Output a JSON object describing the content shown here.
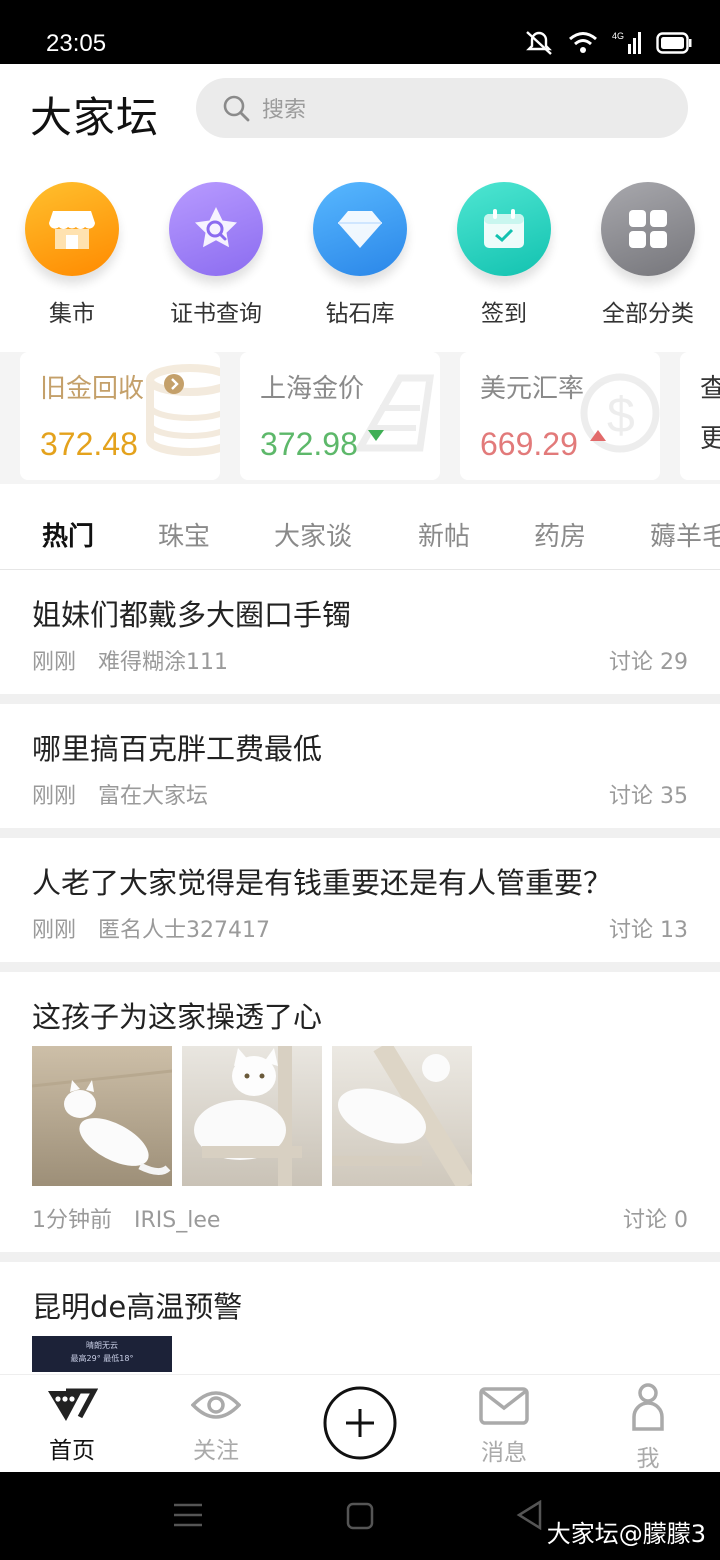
{
  "status": {
    "time": "23:05",
    "network": "4G"
  },
  "header": {
    "logo": "大家坛",
    "search_placeholder": "搜索"
  },
  "categories": [
    {
      "label": "集市",
      "icon": "shop-icon",
      "color": "#ff9a12"
    },
    {
      "label": "证书查询",
      "icon": "certificate-search-icon",
      "color": "#9b7cf0"
    },
    {
      "label": "钻石库",
      "icon": "diamond-icon",
      "color": "#3a9bf0"
    },
    {
      "label": "签到",
      "icon": "calendar-checkin-icon",
      "color": "#25d0c0"
    },
    {
      "label": "全部分类",
      "icon": "grid-icon",
      "color": "#8e8e93"
    }
  ],
  "price_cards": [
    {
      "title": "旧金回收",
      "value": "372.48",
      "title_color": "#c4a06a",
      "value_color": "#e4a21c",
      "has_arrow_link": true
    },
    {
      "title": "上海金价",
      "value": "372.98",
      "title_color": "#8a8a8a",
      "value_color": "#5db86a",
      "trend": "down"
    },
    {
      "title": "美元汇率",
      "value": "669.29",
      "title_color": "#8a8a8a",
      "value_color": "#e27a7a",
      "trend": "up"
    },
    {
      "title": "查",
      "value": "更",
      "title_color": "#333",
      "value_color": "#333"
    }
  ],
  "tabs": [
    "热门",
    "珠宝",
    "大家谈",
    "新帖",
    "药房",
    "薅羊毛"
  ],
  "posts": [
    {
      "title": "姐妹们都戴多大圈口手镯",
      "time": "刚刚",
      "author": "难得糊涂111",
      "discuss_label": "讨论",
      "discuss_count": "29"
    },
    {
      "title": "哪里搞百克胖工费最低",
      "time": "刚刚",
      "author": "富在大家坛",
      "discuss_label": "讨论",
      "discuss_count": "35"
    },
    {
      "title": "人老了大家觉得是有钱重要还是有人管重要？",
      "time": "刚刚",
      "author": "匿名人士327417",
      "discuss_label": "讨论",
      "discuss_count": "13"
    },
    {
      "title": "这孩子为这家操透了心",
      "time": "1分钟前",
      "author": "IRIS_lee",
      "discuss_label": "讨论",
      "discuss_count": "0"
    },
    {
      "title": "昆明de高温预警",
      "thumb_text_1": "晴朗无云",
      "thumb_text_2": "最高29° 最低18°"
    }
  ],
  "bottom_nav": [
    {
      "label": "首页",
      "icon": "home-diamond-icon",
      "active": true
    },
    {
      "label": "关注",
      "icon": "eye-icon"
    },
    {
      "label": "",
      "icon": "plus-circle-icon"
    },
    {
      "label": "消息",
      "icon": "mail-icon"
    },
    {
      "label": "我",
      "icon": "person-icon"
    }
  ],
  "watermark": "大家坛@朦朦3"
}
